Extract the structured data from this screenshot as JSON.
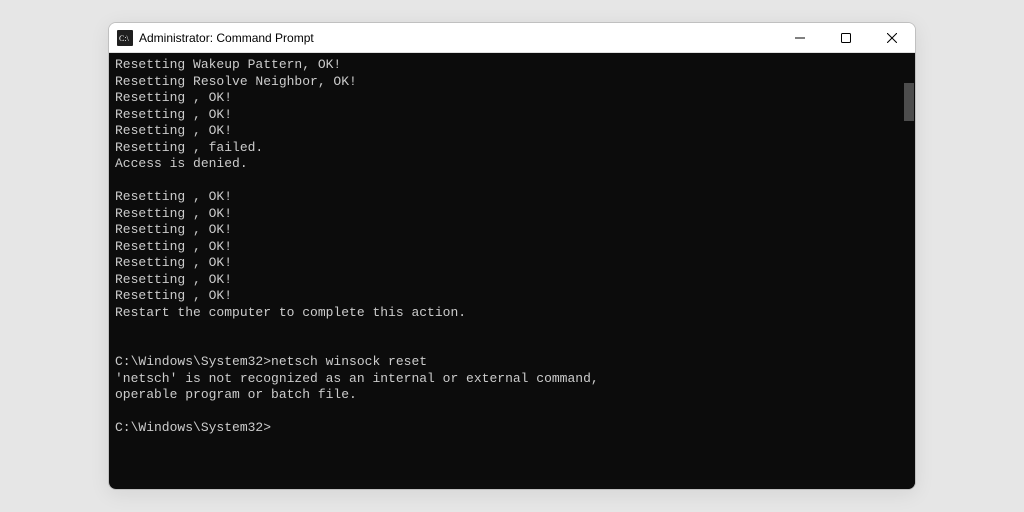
{
  "window": {
    "title": "Administrator: Command Prompt",
    "icon": "cmd-icon"
  },
  "terminal": {
    "lines": [
      "Resetting Wakeup Pattern, OK!",
      "Resetting Resolve Neighbor, OK!",
      "Resetting , OK!",
      "Resetting , OK!",
      "Resetting , OK!",
      "Resetting , failed.",
      "Access is denied.",
      "",
      "Resetting , OK!",
      "Resetting , OK!",
      "Resetting , OK!",
      "Resetting , OK!",
      "Resetting , OK!",
      "Resetting , OK!",
      "Resetting , OK!",
      "Restart the computer to complete this action.",
      "",
      "",
      "C:\\Windows\\System32>netsch winsock reset",
      "'netsch' is not recognized as an internal or external command,",
      "operable program or batch file.",
      "",
      "C:\\Windows\\System32>"
    ]
  }
}
